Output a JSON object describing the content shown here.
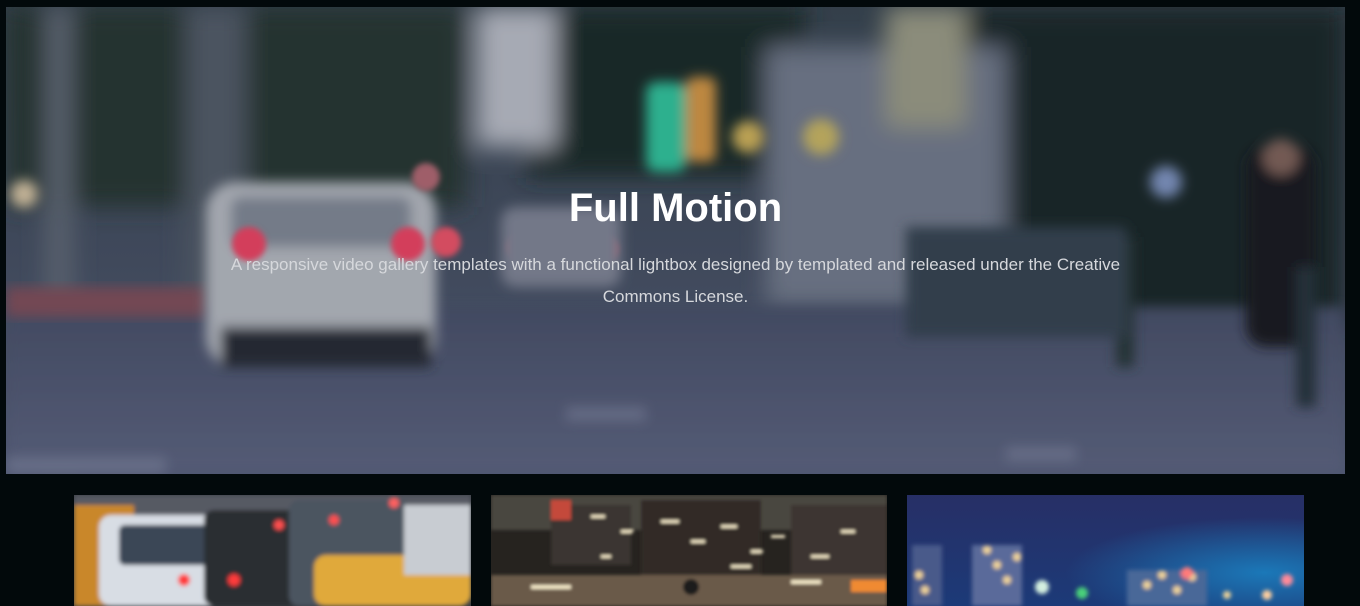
{
  "hero": {
    "title": "Full Motion",
    "description": "A responsive video gallery templates with a functional lightbox designed by templated and released under the Creative Commons License."
  },
  "gallery": {
    "items": [
      {
        "image": "traffic-taxis-thumbnail"
      },
      {
        "image": "city-night-motion-thumbnail"
      },
      {
        "image": "city-bokeh-skyline-thumbnail"
      }
    ]
  },
  "colors": {
    "page_background": "#02090b",
    "title_text": "#ffffff",
    "description_text": "#d6d8dc"
  }
}
